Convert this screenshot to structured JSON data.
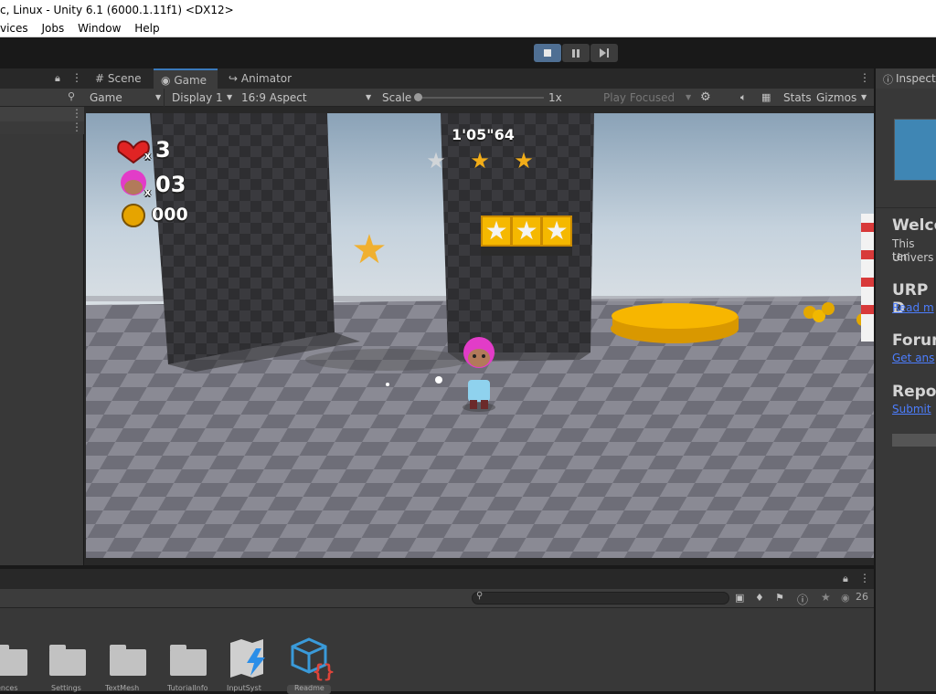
{
  "window": {
    "title": "c, Linux - Unity 6.1 (6000.1.11f1) <DX12>"
  },
  "menu": {
    "items": [
      "vices",
      "Jobs",
      "Window",
      "Help"
    ]
  },
  "playbar": {
    "play_icon": "stop-icon",
    "pause_icon": "pause-icon",
    "step_icon": "step-icon"
  },
  "tabs": {
    "scene": "Scene",
    "game": "Game",
    "animator": "Animator",
    "inspector": "Inspecto"
  },
  "gamebar": {
    "mode": "Game",
    "display": "Display 1",
    "aspect": "16:9 Aspect",
    "scale_label": "Scale",
    "scale_value": "1x",
    "play_focused": "Play Focused",
    "stats": "Stats",
    "gizmos": "Gizmos"
  },
  "hud": {
    "lives": "3",
    "lives_x": "x",
    "characters": "03",
    "characters_x": "x",
    "coins": "000",
    "timer": "1'05\"64"
  },
  "inspector": {
    "welcome_title": "Welco",
    "welcome_text1": "This ten",
    "welcome_text2": "Univers",
    "urp_title": "URP D",
    "urp_link": "Read m",
    "forum_title": "Forum",
    "forum_link": "Get ans",
    "report_title": "Repor",
    "report_link": "Submit"
  },
  "project": {
    "search_placeholder": "",
    "hidden_count": "26",
    "items": [
      "ences",
      "Settings",
      "TextMesh",
      "TutorialInfo",
      "InputSyst",
      "Readme"
    ]
  },
  "colors": {
    "accent": "#3a79bb",
    "link": "#4c7eff",
    "panel": "#383838",
    "dark": "#282828"
  }
}
